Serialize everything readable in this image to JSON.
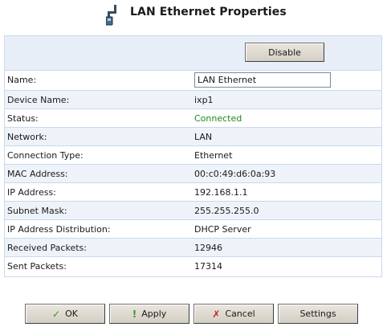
{
  "header": {
    "title": "LAN Ethernet Properties",
    "icon": "network-cable-icon"
  },
  "toolbar": {
    "disable_label": "Disable"
  },
  "form": {
    "name_label": "Name:",
    "name_value": "LAN Ethernet"
  },
  "properties": [
    {
      "label": "Device Name:",
      "value": "ixp1"
    },
    {
      "label": "Status:",
      "value": "Connected"
    },
    {
      "label": "Network:",
      "value": "LAN"
    },
    {
      "label": "Connection Type:",
      "value": "Ethernet"
    },
    {
      "label": "MAC Address:",
      "value": "00:c0:49:d6:0a:93"
    },
    {
      "label": "IP Address:",
      "value": "192.168.1.1"
    },
    {
      "label": "Subnet Mask:",
      "value": "255.255.255.0"
    },
    {
      "label": "IP Address Distribution:",
      "value": "DHCP Server"
    },
    {
      "label": "Received Packets:",
      "value": "12946"
    },
    {
      "label": "Sent Packets:",
      "value": "17314"
    }
  ],
  "buttons": {
    "ok_label": "OK",
    "ok_icon": "checkmark-icon",
    "apply_label": "Apply",
    "apply_icon": "exclamation-icon",
    "cancel_label": "Cancel",
    "cancel_icon": "x-icon",
    "settings_label": "Settings"
  },
  "colors": {
    "status_ok": "#1f8a1f",
    "panel_border": "#c9d9ec",
    "row_alt": "#eef3fa"
  }
}
